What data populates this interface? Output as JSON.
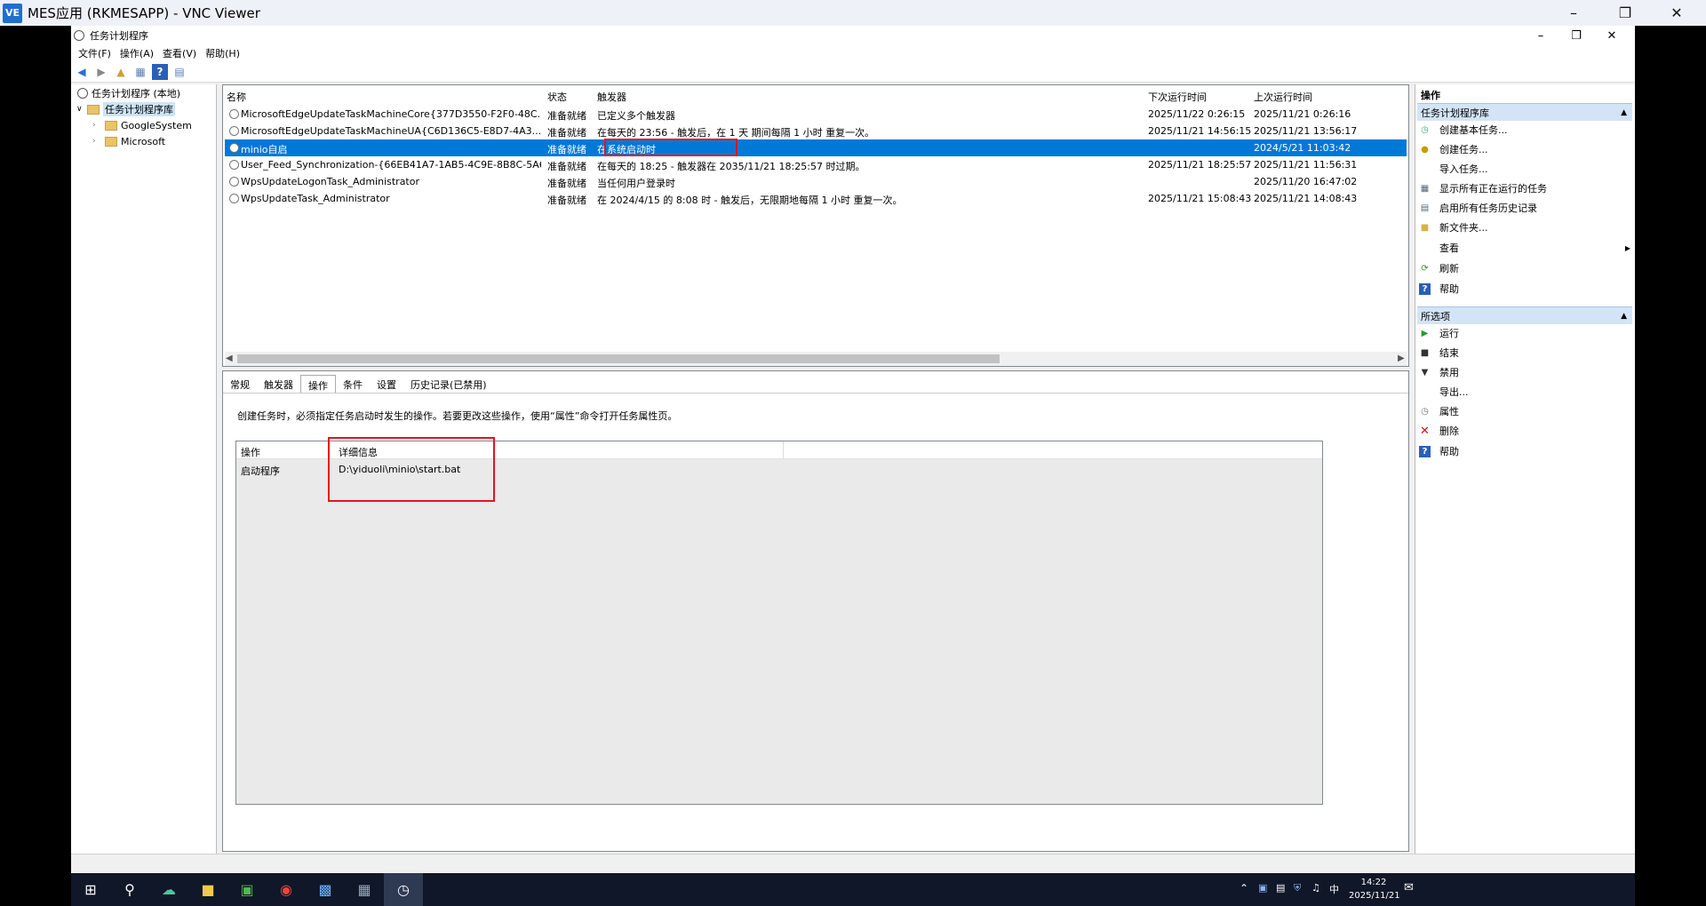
{
  "vnc": {
    "logo": "VE",
    "title": "MES应用 (RKMESAPP) - VNC Viewer"
  },
  "app": {
    "title": "任务计划程序"
  },
  "menu": [
    "文件(F)",
    "操作(A)",
    "查看(V)",
    "帮助(H)"
  ],
  "tree": {
    "root": "任务计划程序 (本地)",
    "library": "任务计划程序库",
    "children": [
      "GoogleSystem",
      "Microsoft"
    ]
  },
  "grid": {
    "headers": [
      "名称",
      "状态",
      "触发器",
      "下次运行时间",
      "上次运行时间"
    ],
    "rows": [
      {
        "name": "MicrosoftEdgeUpdateTaskMachineCore{377D3550-F2F0-48C...",
        "status": "准备就绪",
        "trigger": "已定义多个触发器",
        "next": "2025/11/22 0:26:15",
        "last": "2025/11/21 0:26:16"
      },
      {
        "name": "MicrosoftEdgeUpdateTaskMachineUA{C6D136C5-E8D7-4A3...",
        "status": "准备就绪",
        "trigger": "在每天的 23:56 - 触发后，在 1 天 期间每隔 1 小时 重复一次。",
        "next": "2025/11/21 14:56:15",
        "last": "2025/11/21 13:56:17"
      },
      {
        "name": "minio自启",
        "status": "准备就绪",
        "trigger": "在系统启动时",
        "next": "",
        "last": "2024/5/21 11:03:42"
      },
      {
        "name": "User_Feed_Synchronization-{66EB41A7-1AB5-4C9E-8B8C-5A6...",
        "status": "准备就绪",
        "trigger": "在每天的 18:25 - 触发器在 2035/11/21 18:25:57 时过期。",
        "next": "2025/11/21 18:25:57",
        "last": "2025/11/21 11:56:31"
      },
      {
        "name": "WpsUpdateLogonTask_Administrator",
        "status": "准备就绪",
        "trigger": "当任何用户登录时",
        "next": "",
        "last": "2025/11/20 16:47:02"
      },
      {
        "name": "WpsUpdateTask_Administrator",
        "status": "准备就绪",
        "trigger": "在 2024/4/15 的 8:08 时 - 触发后，无限期地每隔 1 小时 重复一次。",
        "next": "2025/11/21 15:08:43",
        "last": "2025/11/21 14:08:43"
      }
    ]
  },
  "tabs": [
    "常规",
    "触发器",
    "操作",
    "条件",
    "设置",
    "历史记录(已禁用)"
  ],
  "detail": {
    "description": "创建任务时，必须指定任务启动时发生的操作。若要更改这些操作，使用“属性”命令打开任务属性页。",
    "col_action": "操作",
    "col_detail": "详细信息",
    "action": "启动程序",
    "path": "D:\\yiduoli\\minio\\start.bat"
  },
  "actions": {
    "pane_title": "操作",
    "section1": "任务计划程序库",
    "items1": [
      "创建基本任务...",
      "创建任务...",
      "导入任务...",
      "显示所有正在运行的任务",
      "启用所有任务历史记录",
      "新文件夹...",
      "查看",
      "刷新",
      "帮助"
    ],
    "section2": "所选项",
    "items2": [
      "运行",
      "结束",
      "禁用",
      "导出...",
      "属性",
      "删除",
      "帮助"
    ]
  },
  "taskbar": {
    "time": "14:22",
    "date": "2025/11/21",
    "ime": "中"
  }
}
